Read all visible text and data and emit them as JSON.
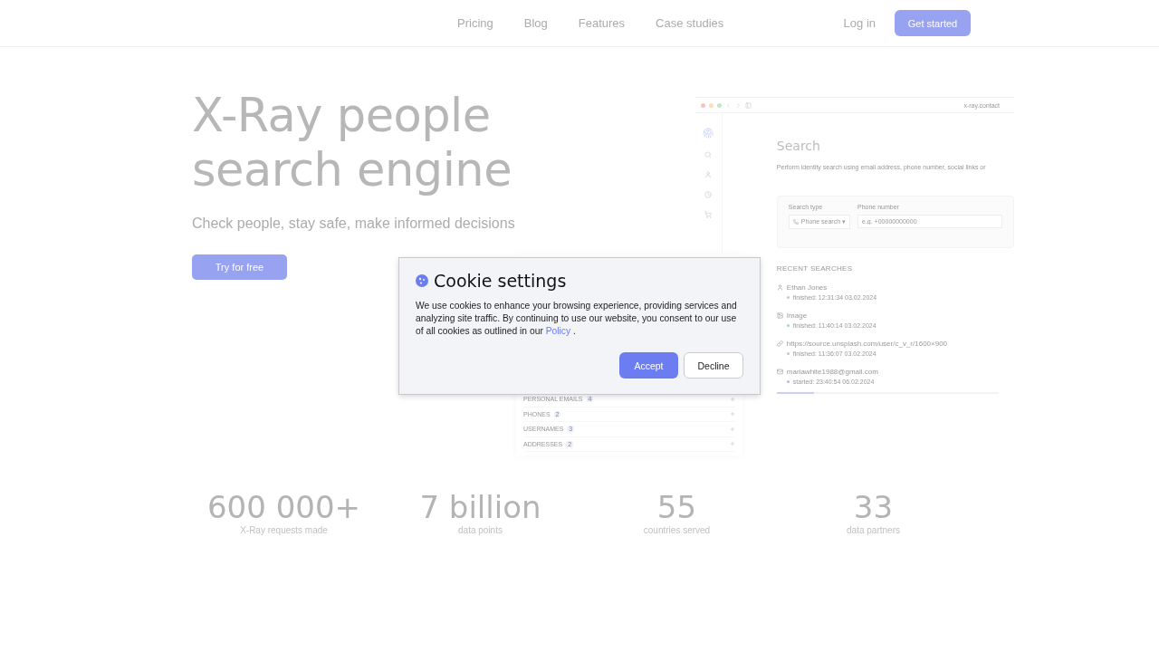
{
  "nav": {
    "links": [
      "Pricing",
      "Blog",
      "Features",
      "Case studies"
    ],
    "login": "Log in",
    "cta": "Get started"
  },
  "hero": {
    "title_lines": [
      "X-Ray people",
      "search engine"
    ],
    "subtitle": "Check people, stay safe, make informed decisions",
    "button": "Try for free"
  },
  "preview": {
    "url": "x-ray.contact",
    "heading": "Search",
    "description": "Perform identity search using email address, phone number, social links or",
    "form": {
      "type_label": "Search type",
      "type_value": "Phone search ▾",
      "field_label": "Phone number",
      "placeholder": "e.g. +00000000000"
    },
    "recent_title": "RECENT SEARCHES",
    "recent": [
      {
        "name": "Ethan Jones",
        "status": "finished: 12:31:34 03.02.2024",
        "color": "#a8d8b8"
      },
      {
        "name": "Image",
        "status": "finished: 11:40:14 03.02.2024",
        "color": "#a8d8b8"
      },
      {
        "name": "https://source.unsplash.com/user/c_v_r/1600×900",
        "status": "finished: 11:36:07 03.02.2024",
        "color": "#a8d8b8"
      },
      {
        "name": "mariawhite1988@gmail.com",
        "status": "started: 23:40:54 06.02.2024",
        "color": "#b8b8e8"
      }
    ],
    "progress": {
      "level": 0.17
    },
    "categories": [
      {
        "label": "PERSONAL EMAILS",
        "count": "4"
      },
      {
        "label": "PHONES",
        "count": "2"
      },
      {
        "label": "USERNAMES",
        "count": "3"
      },
      {
        "label": "ADDRESSES",
        "count": "2"
      }
    ]
  },
  "stats": [
    {
      "value": "600 000+",
      "label": "X-Ray requests made"
    },
    {
      "value": "7 billion",
      "label": "data points"
    },
    {
      "value": "55",
      "label": "countries served"
    },
    {
      "value": "33",
      "label": "data partners"
    }
  ],
  "cookie_dialog": {
    "title": "Cookie settings",
    "text_before": "We use cookies to enhance your browsing experience, providing services and analyzing site traffic. By continuing to use our website, you consent to our use of all cookies as outlined in our",
    "link": "Policy",
    "text_after": ".",
    "accept": "Accept",
    "decline": "Decline"
  }
}
